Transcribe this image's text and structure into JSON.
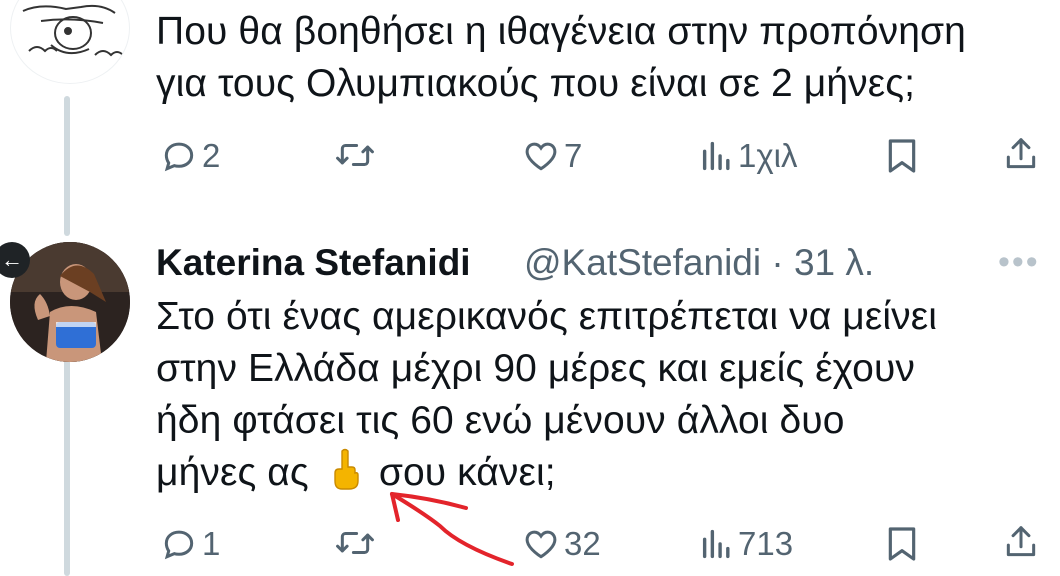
{
  "tweet1": {
    "text_line1": "Που θα βοηθήσει η ιθαγένεια στην προπόνηση",
    "text_line2": "για τους Ολυμπιακούς που είναι σε 2 μήνες;",
    "actions": {
      "replies": "2",
      "retweets": "",
      "likes": "7",
      "views": "1χιλ"
    }
  },
  "tweet2": {
    "author_name": "Katerina Stefanidi",
    "author_handle": "@KatStefanidi · 31 λ.",
    "more": "•••",
    "text_line1": "Στο ότι ένας αμερικανός επιτρέπεται να μείνει",
    "text_line2": "στην Ελλάδα μέχρι 90 μέρες και εμείς έχουν",
    "text_line3": "ήδη φτάσει τις 60 ενώ μένουν άλλοι δυο",
    "text_line4_before": "μήνες ας",
    "text_line4_after": "σου κάνει;",
    "actions": {
      "replies": "1",
      "retweets": "",
      "likes": "32",
      "views": "713"
    }
  },
  "colors": {
    "text": "#0f1419",
    "muted": "#536471",
    "thread_line": "#cfd9de",
    "annotation_arrow": "#e3242b"
  },
  "icons": [
    "reply-icon",
    "retweet-icon",
    "like-icon",
    "views-icon",
    "bookmark-icon",
    "share-icon",
    "back-arrow-icon",
    "middle-finger-emoji"
  ]
}
